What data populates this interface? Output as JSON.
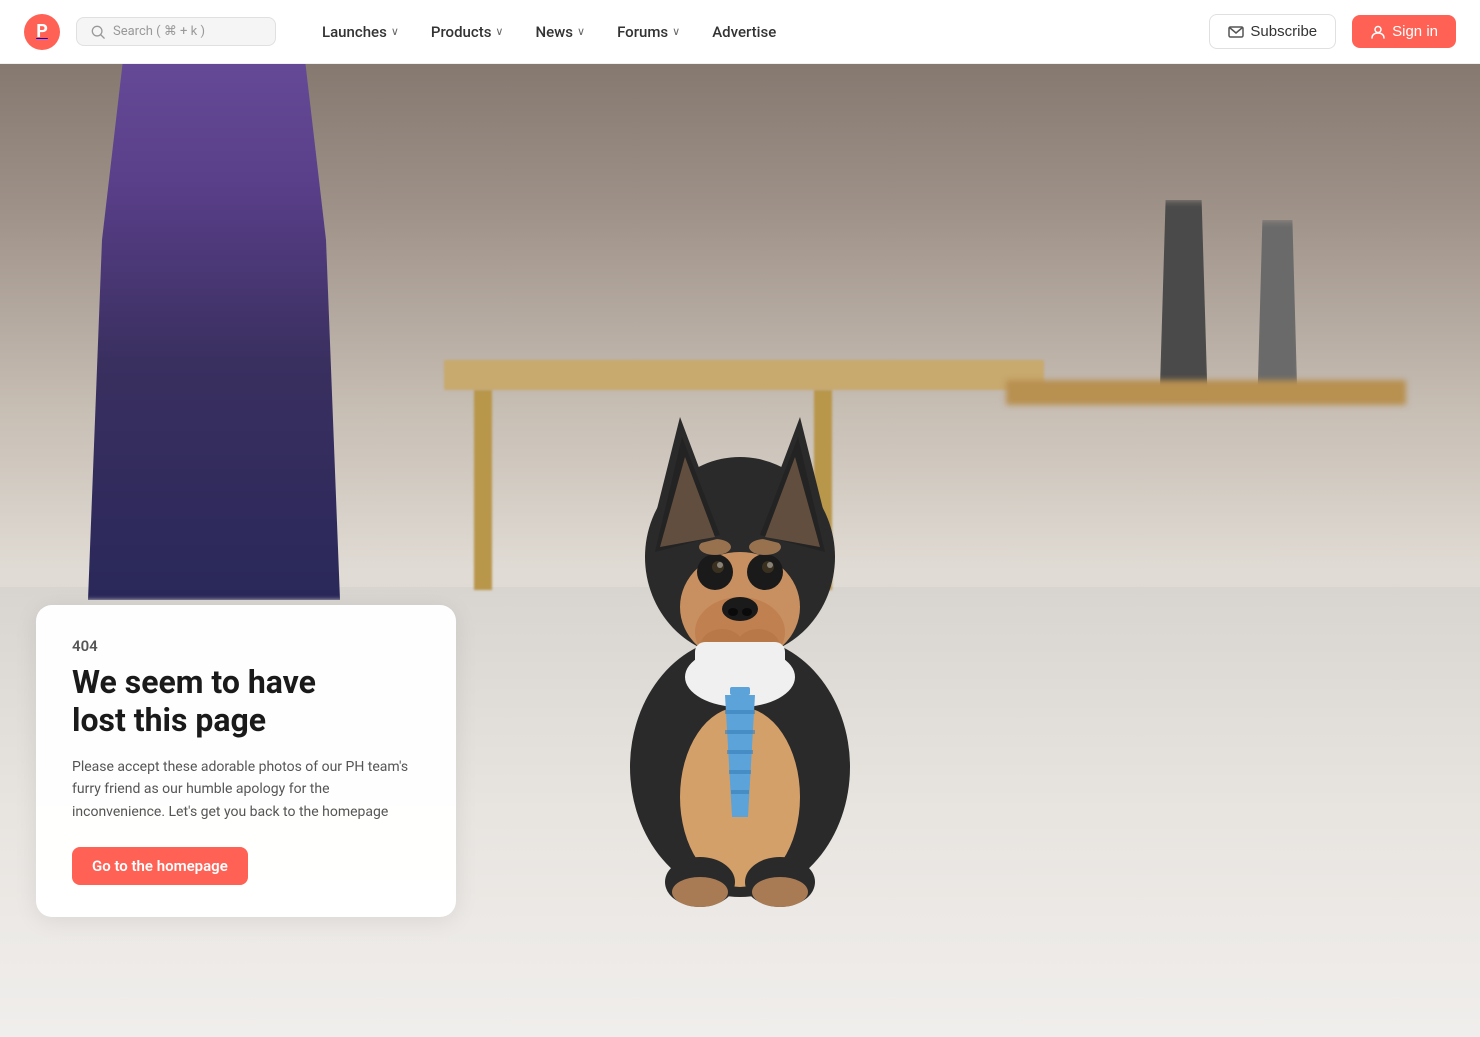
{
  "brand": {
    "logo_letter": "P",
    "logo_bg": "#ff6154"
  },
  "navbar": {
    "search_placeholder": "Search ( ⌘ + k )",
    "nav_items": [
      {
        "id": "launches",
        "label": "Launches",
        "has_dropdown": true
      },
      {
        "id": "products",
        "label": "Products",
        "has_dropdown": true
      },
      {
        "id": "news",
        "label": "News",
        "has_dropdown": true
      },
      {
        "id": "forums",
        "label": "Forums",
        "has_dropdown": true
      },
      {
        "id": "advertise",
        "label": "Advertise",
        "has_dropdown": false
      }
    ],
    "subscribe_label": "Subscribe",
    "signin_label": "Sign in"
  },
  "error_page": {
    "error_code": "404",
    "title_line1": "We seem to have",
    "title_line2": "lost this page",
    "description": "Please accept these adorable photos of our PH team's furry friend as our humble apology for the inconvenience. Let's get you back to the homepage",
    "cta_label": "Go to the homepage"
  },
  "icons": {
    "search": "🔍",
    "envelope": "✉",
    "user": "👤",
    "chevron": "›"
  }
}
